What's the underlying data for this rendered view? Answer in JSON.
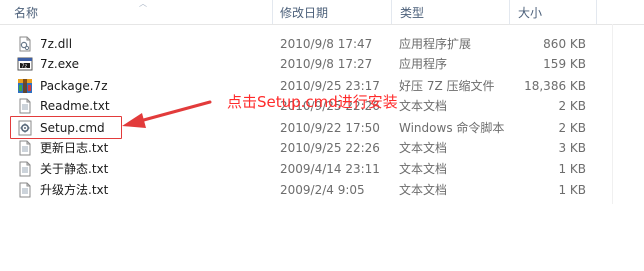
{
  "header": {
    "name": "名称",
    "date": "修改日期",
    "type": "类型",
    "size": "大小"
  },
  "files": [
    {
      "name": "7z.dll",
      "date": "2010/9/8 17:47",
      "type": "应用程序扩展",
      "size": "860 KB",
      "icon": "dll-file-icon"
    },
    {
      "name": "7z.exe",
      "date": "2010/9/8 17:27",
      "type": "应用程序",
      "size": "159 KB",
      "icon": "exe-app-icon"
    },
    {
      "name": "Package.7z",
      "date": "2010/9/25 23:17",
      "type": "好压 7Z 压缩文件",
      "size": "18,386 KB",
      "icon": "archive-7z-icon"
    },
    {
      "name": "Readme.txt",
      "date": "2010/9/25 22:26",
      "type": "文本文档",
      "size": "2 KB",
      "icon": "text-file-icon"
    },
    {
      "name": "Setup.cmd",
      "date": "2010/9/22 17:50",
      "type": "Windows 命令脚本",
      "size": "2 KB",
      "icon": "cmd-script-icon"
    },
    {
      "name": "更新日志.txt",
      "date": "2010/9/25 22:26",
      "type": "文本文档",
      "size": "3 KB",
      "icon": "text-file-icon"
    },
    {
      "name": "关于静态.txt",
      "date": "2009/4/14 23:11",
      "type": "文本文档",
      "size": "1 KB",
      "icon": "text-file-icon"
    },
    {
      "name": "升级方法.txt",
      "date": "2009/2/4 9:05",
      "type": "文本文档",
      "size": "1 KB",
      "icon": "text-file-icon"
    }
  ],
  "annotation": {
    "text": "点击Setup.cmd进行安装",
    "color": "#ff2b2b"
  }
}
